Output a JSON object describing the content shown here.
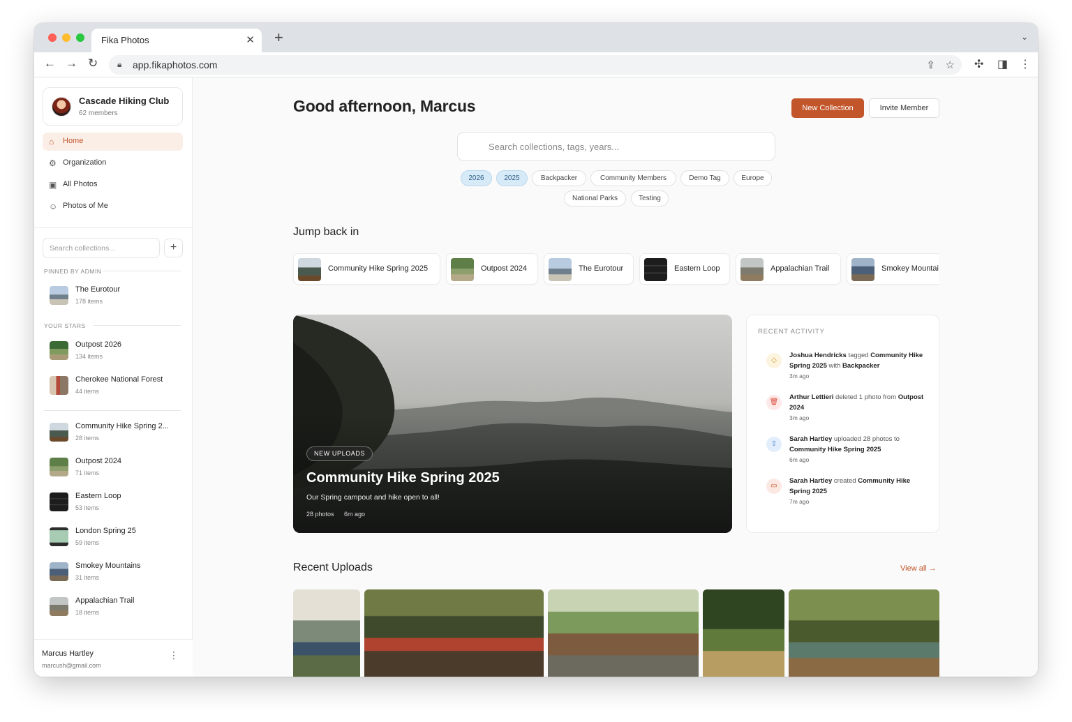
{
  "browser": {
    "tab_title": "Fika Photos",
    "url": "app.fikaphotos.com"
  },
  "sidebar": {
    "club_name": "Cascade Hiking Club",
    "club_members": "62 members",
    "nav": [
      {
        "label": "Home",
        "icon": "home-icon",
        "active": true
      },
      {
        "label": "Organization",
        "icon": "gear-icon",
        "active": false
      },
      {
        "label": "All Photos",
        "icon": "image-icon",
        "active": false
      },
      {
        "label": "Photos of Me",
        "icon": "smile-icon",
        "active": false
      }
    ],
    "search_placeholder": "Search collections...",
    "pinned_label": "PINNED BY ADMIN",
    "pinned": [
      {
        "name": "The Eurotour",
        "count": "178 items"
      }
    ],
    "stars_label": "YOUR STARS",
    "stars": [
      {
        "name": "Outpost 2026",
        "count": "134 items"
      },
      {
        "name": "Cherokee National Forest",
        "count": "44 items"
      }
    ],
    "collections": [
      {
        "name": "Community Hike Spring 2...",
        "count": "28 items"
      },
      {
        "name": "Outpost 2024",
        "count": "71 items"
      },
      {
        "name": "Eastern Loop",
        "count": "53 items"
      },
      {
        "name": "London Spring 25",
        "count": "59 items"
      },
      {
        "name": "Smokey Mountains",
        "count": "31 items"
      },
      {
        "name": "Appalachian Trail",
        "count": "18 items"
      }
    ],
    "user": {
      "name": "Marcus Hartley",
      "email": "marcush@gmail.com"
    }
  },
  "main": {
    "greeting": "Good afternoon, Marcus",
    "new_collection": "New Collection",
    "invite_member": "Invite Member",
    "search_placeholder": "Search collections, tags, years...",
    "chips": [
      {
        "label": "2026",
        "selected": true
      },
      {
        "label": "2025",
        "selected": true
      },
      {
        "label": "Backpacker",
        "selected": false
      },
      {
        "label": "Community Members",
        "selected": false
      },
      {
        "label": "Demo Tag",
        "selected": false
      },
      {
        "label": "Europe",
        "selected": false
      },
      {
        "label": "National Parks",
        "selected": false
      },
      {
        "label": "Testing",
        "selected": false
      }
    ],
    "jump_title": "Jump back in",
    "jump": [
      "Community Hike Spring 2025",
      "Outpost 2024",
      "The Eurotour",
      "Eastern Loop",
      "Appalachian Trail",
      "Smokey Mountai"
    ],
    "hero": {
      "badge": "NEW UPLOADS",
      "title": "Community Hike Spring 2025",
      "description": "Our Spring campout and hike open to all!",
      "photos": "28 photos",
      "time": "6m ago"
    },
    "activity": {
      "title": "RECENT ACTIVITY",
      "items": [
        {
          "icon": "tag-icon",
          "actor": "Joshua Hendricks",
          "verb": "tagged",
          "object": "Community Hike Spring 2025",
          "extra_verb": "with",
          "extra": "Backpacker",
          "time": "3m ago"
        },
        {
          "icon": "trash-icon",
          "actor": "Arthur Lettieri",
          "verb": "deleted 1 photo from",
          "object": "Outpost 2024",
          "extra_verb": "",
          "extra": "",
          "time": "3m ago"
        },
        {
          "icon": "upload-icon",
          "actor": "Sarah Hartley",
          "verb": "uploaded 28 photos to",
          "object": "Community Hike Spring 2025",
          "extra_verb": "",
          "extra": "",
          "time": "6m ago"
        },
        {
          "icon": "folder-icon",
          "actor": "Sarah Hartley",
          "verb": "created",
          "object": "Community Hike Spring 2025",
          "extra_verb": "",
          "extra": "",
          "time": "7m ago"
        }
      ]
    },
    "uploads_title": "Recent Uploads",
    "view_all": "View all →"
  },
  "colors": {
    "accent": "#c2552a",
    "chip_selected_bg": "#d7eaf8"
  }
}
